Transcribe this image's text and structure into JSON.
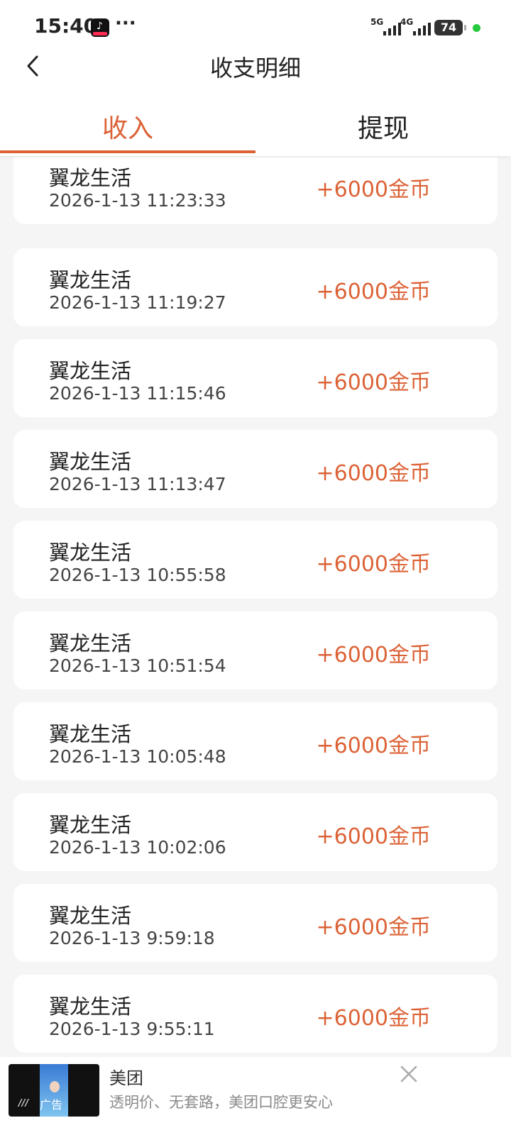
{
  "status_bar": {
    "time": "15:40",
    "dots": "···",
    "network1": "5G",
    "network2": "4G",
    "battery": "74"
  },
  "header": {
    "title": "收支明细"
  },
  "tabs": [
    {
      "label": "收入",
      "active": true
    },
    {
      "label": "提现",
      "active": false
    }
  ],
  "colors": {
    "accent": "#dc6236"
  },
  "records": [
    {
      "name": "翼龙生活",
      "time": "2026-1-13 11:23:33",
      "amount": "+6000金币"
    },
    {
      "name": "翼龙生活",
      "time": "2026-1-13 11:19:27",
      "amount": "+6000金币"
    },
    {
      "name": "翼龙生活",
      "time": "2026-1-13 11:15:46",
      "amount": "+6000金币"
    },
    {
      "name": "翼龙生活",
      "time": "2026-1-13 11:13:47",
      "amount": "+6000金币"
    },
    {
      "name": "翼龙生活",
      "time": "2026-1-13 10:55:58",
      "amount": "+6000金币"
    },
    {
      "name": "翼龙生活",
      "time": "2026-1-13 10:51:54",
      "amount": "+6000金币"
    },
    {
      "name": "翼龙生活",
      "time": "2026-1-13 10:05:48",
      "amount": "+6000金币"
    },
    {
      "name": "翼龙生活",
      "time": "2026-1-13 10:02:06",
      "amount": "+6000金币"
    },
    {
      "name": "翼龙生活",
      "time": "2026-1-13 9:59:18",
      "amount": "+6000金币"
    },
    {
      "name": "翼龙生活",
      "time": "2026-1-13 9:55:11",
      "amount": "+6000金币"
    }
  ],
  "ad": {
    "label": "广告",
    "title": "美团",
    "description": "透明价、无套路，美团口腔更安心"
  }
}
